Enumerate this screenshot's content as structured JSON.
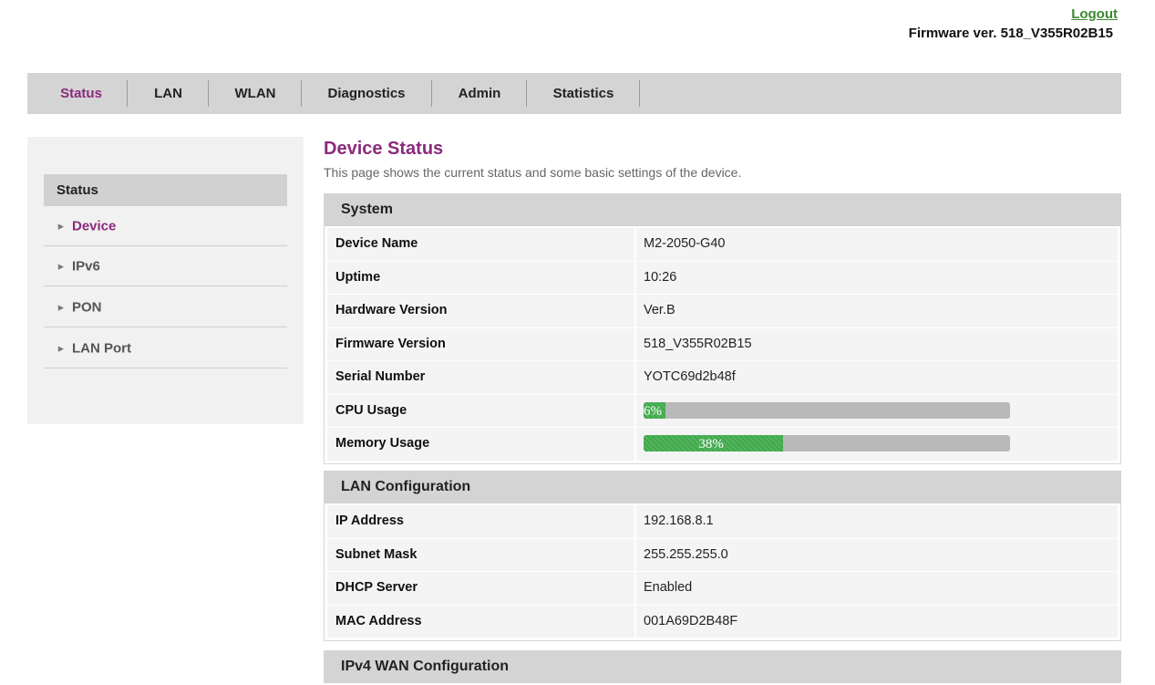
{
  "header": {
    "logout": "Logout",
    "firmware": "Firmware ver. 518_V355R02B15"
  },
  "topnav": {
    "items": [
      "Status",
      "LAN",
      "WLAN",
      "Diagnostics",
      "Admin",
      "Statistics"
    ],
    "active": "Status"
  },
  "sidebar": {
    "heading": "Status",
    "items": [
      "Device",
      "IPv6",
      "PON",
      "LAN Port"
    ],
    "active": "Device"
  },
  "page": {
    "title": "Device Status",
    "description": "This page shows the current status and some basic settings of the device."
  },
  "system": {
    "title": "System",
    "rows": [
      {
        "label": "Device Name",
        "value": "M2-2050-G40"
      },
      {
        "label": "Uptime",
        "value": "10:26"
      },
      {
        "label": "Hardware Version",
        "value": "Ver.B"
      },
      {
        "label": "Firmware Version",
        "value": "518_V355R02B15"
      },
      {
        "label": "Serial Number",
        "value": "YOTC69d2b48f"
      }
    ],
    "cpu": {
      "label": "CPU Usage",
      "text": "6%",
      "percent": 6
    },
    "memory": {
      "label": "Memory Usage",
      "text": "38%",
      "percent": 38
    }
  },
  "lan": {
    "title": "LAN Configuration",
    "rows": [
      {
        "label": "IP Address",
        "value": "192.168.8.1"
      },
      {
        "label": "Subnet Mask",
        "value": "255.255.255.0"
      },
      {
        "label": "DHCP Server",
        "value": "Enabled"
      },
      {
        "label": "MAC Address",
        "value": "001A69D2B48F"
      }
    ]
  },
  "wan": {
    "title": "IPv4 WAN Configuration"
  },
  "colors": {
    "accent": "#8b2a7c",
    "link": "#3a8a2e",
    "progress": "#4fb55b"
  }
}
